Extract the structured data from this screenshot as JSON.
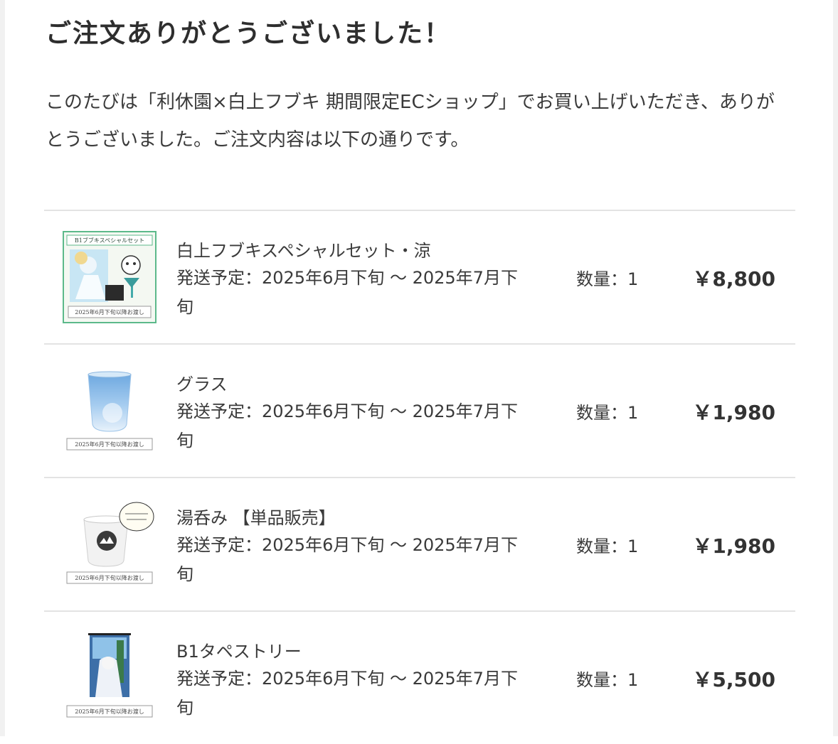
{
  "page": {
    "title": "ご注文ありがとうございました！",
    "intro": "このたびは「利休園×白上フブキ 期間限定ECショップ」でお買い上げいただき、ありがとうございました。ご注文内容は以下の通りです。"
  },
  "items": [
    {
      "name": "白上フブキスペシャルセット・涼",
      "shipping": "発送予定：2025年6月下旬 〜 2025年7月下旬",
      "quantity": "数量：1",
      "price": "￥8,800",
      "image_icon": "special-set-product-icon",
      "image_header": "B1ブブキスペシャルセット",
      "image_caption": "2025年6月下旬以降お渡し"
    },
    {
      "name": "グラス",
      "shipping": "発送予定：2025年6月下旬 〜 2025年7月下旬",
      "quantity": "数量：1",
      "price": "￥1,980",
      "image_icon": "glass-product-icon",
      "image_caption": "2025年6月下旬以降お渡し"
    },
    {
      "name": "湯呑み 【単品販売】",
      "shipping": "発送予定：2025年6月下旬 〜 2025年7月下旬",
      "quantity": "数量：1",
      "price": "￥1,980",
      "image_icon": "teacup-product-icon",
      "image_caption": "2025年6月下旬以降お渡し"
    },
    {
      "name": "B1タペストリー",
      "shipping": "発送予定：2025年6月下旬 〜 2025年7月下旬",
      "quantity": "数量：1",
      "price": "￥5,500",
      "image_icon": "tapestry-product-icon",
      "image_caption": "2025年6月下旬以降お渡し"
    }
  ],
  "colors": {
    "text": "#333333",
    "divider": "#e3e3e3",
    "thumb_border": "#5cb98a",
    "glass_blue": "#7fb6e6"
  }
}
